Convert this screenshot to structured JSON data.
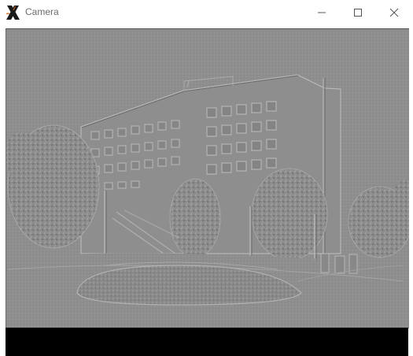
{
  "window": {
    "title": "Camera",
    "icon": "x-app-icon",
    "controls": {
      "minimize_icon": "minimize-icon",
      "maximize_icon": "maximize-icon",
      "close_icon": "close-icon"
    }
  },
  "view": {
    "content": "embossed-grayscale-camera-frame"
  },
  "colors": {
    "emboss_gray": "#8e8e8e",
    "titlebar_bg": "#ffffff",
    "title_text": "#6d6d6d",
    "frame_bottom": "#000000"
  }
}
